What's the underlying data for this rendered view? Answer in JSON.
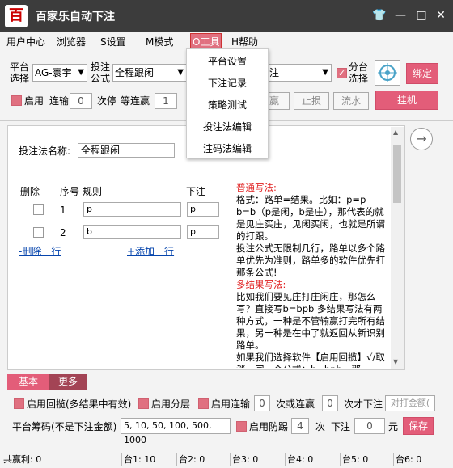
{
  "app": {
    "title": "百家乐自动下注",
    "logo": "百"
  },
  "window_controls": {
    "skin": "👕",
    "minimize": "—",
    "maximize": "□",
    "close": "✕"
  },
  "menu": [
    "用户中心",
    "浏览器",
    "S设置",
    "M模式",
    "O工具",
    "H帮助"
  ],
  "dropdown": [
    "平台设置",
    "下注记录",
    "策略测试",
    "投注法编辑",
    "注码法编辑"
  ],
  "settings": {
    "platform_label_1": "平台",
    "platform_label_2": "选择",
    "platform_value": "AG-寰宇",
    "formula_label_1": "投注",
    "formula_label_2": "公式",
    "formula_value": "全程跟闲",
    "third_value": "注",
    "split_label_1": "分台",
    "split_label_2": "洗择",
    "bind_button": "绑定",
    "hang_button": "挂机",
    "enable_label": "启用",
    "lose_label": "连输",
    "lose_value": "0",
    "times_label": "次停",
    "wait_label": "等连赢",
    "wait_value": "1",
    "win_button": "赢",
    "stop_loss_button": "止损",
    "flow_button": "流水"
  },
  "panel": {
    "name_label": "投注法名称:",
    "name_value": "全程跟闲",
    "col_delete": "删除",
    "col_seq": "序号",
    "col_rule": "规则",
    "col_bet": "下注",
    "rows": [
      {
        "seq": "1",
        "rule": "p",
        "bet": "p"
      },
      {
        "seq": "2",
        "rule": "b",
        "bet": "p"
      }
    ],
    "delete_link": "-删除一行",
    "add_link": "+添加一行",
    "help_title1": "普通写法:",
    "help_p1": "格式：路单=结果。比如：p=p b=b（p是闲，b是庄），那代表的就是见庄买庄，见闲买闲，也就是所谓的打跟。",
    "help_p2": "投注公式无限制几行，路单以多个路单优先为准则，路单多的软件优先打那条公式!",
    "help_title2": "多结果写法:",
    "help_p3": "比如我们要见庄打庄闲庄，那怎么写？直接写b=bpb 多结果写法有两种方式，一种是不管输赢打完所有结果，另一种是在中了就返回从新识别路单。",
    "help_p4": "如果我们选择软件【启用回揽】√/取消，同一个公式：b=bpb，那"
  },
  "tabs": {
    "basic": "基本",
    "more": "更多"
  },
  "bottom": {
    "back_label": "启用回揽(多结果中有效)",
    "layer_label": "启用分层",
    "streak_label": "启用连输",
    "streak_value": "0",
    "or_label": "次或连赢",
    "or_value": "0",
    "then_label": "次才下注",
    "amount_placeholder": "对打金额(",
    "chips_label": "平台筹码(不是下注金额)",
    "chips_value": "5, 10, 50, 100, 500, 1000",
    "guard_label": "启用防踢",
    "guard_value": "4",
    "guard_times": "次",
    "bet_label": "下注",
    "bet_value": "0",
    "yuan": "元",
    "save_button": "保存"
  },
  "status": [
    "共赢利: 0",
    "台1: 10",
    "台2: 0",
    "台3: 0",
    "台4: 0",
    "台5: 0",
    "台6: 0"
  ]
}
